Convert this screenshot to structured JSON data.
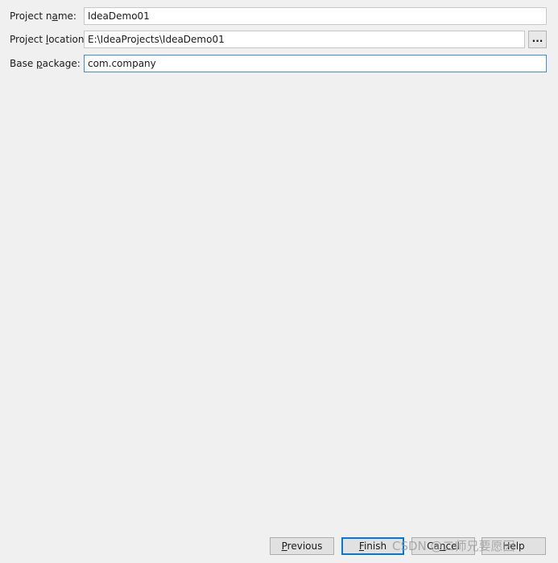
{
  "form": {
    "project_name": {
      "label_pre": "Project n",
      "label_mnemonic": "a",
      "label_post": "me:",
      "value": "IdeaDemo01"
    },
    "project_location": {
      "label_pre": "Project ",
      "label_mnemonic": "l",
      "label_post": "ocation:",
      "value": "E:\\IdeaProjects\\IdeaDemo01",
      "browse_label": "..."
    },
    "base_package": {
      "label_pre": "Base ",
      "label_mnemonic": "p",
      "label_post": "ackage:",
      "value": "com.company"
    }
  },
  "buttons": {
    "previous": {
      "mnemonic": "P",
      "rest": "revious"
    },
    "finish": {
      "mnemonic": "F",
      "rest": "inish"
    },
    "cancel": {
      "pre": "Ca",
      "mnemonic": "n",
      "post": "cel"
    },
    "help": {
      "label": "Help"
    }
  },
  "watermark": {
    "text": "CSDN @二师兄要愿因"
  },
  "colors": {
    "background": "#f0f0f0",
    "focus_border": "#3c8ee0",
    "default_button_border": "#0078d7"
  }
}
